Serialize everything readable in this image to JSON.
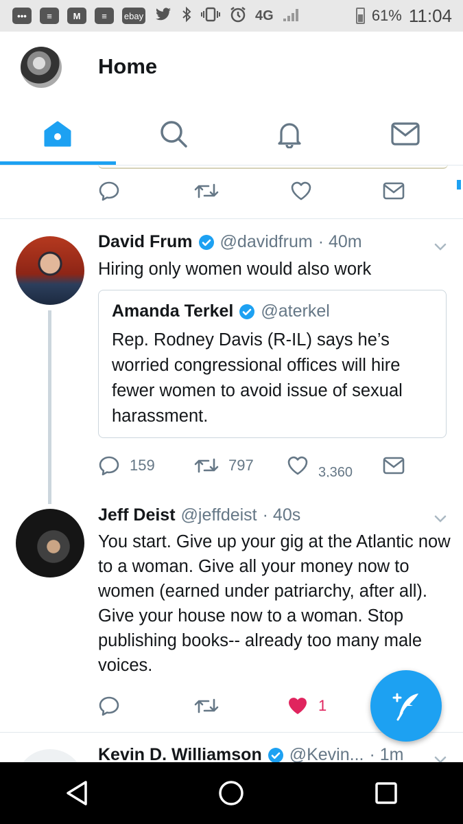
{
  "status_bar": {
    "battery": "61%",
    "time": "11:04",
    "network": "4G",
    "icons": [
      "more-icon",
      "flipboard-icon",
      "gmail-icon",
      "flipboard-icon",
      "ebay-icon",
      "twitter-icon",
      "bluetooth-icon",
      "vibrate-icon",
      "alarm-icon",
      "lte-icon",
      "signal-icon",
      "battery-icon"
    ],
    "ebay_label": "ebay"
  },
  "header": {
    "title": "Home"
  },
  "tabs": [
    {
      "name": "home",
      "icon": "home-icon",
      "active": true
    },
    {
      "name": "search",
      "icon": "search-icon",
      "active": false
    },
    {
      "name": "notifications",
      "icon": "bell-icon",
      "active": false
    },
    {
      "name": "messages",
      "icon": "mail-icon",
      "active": false
    }
  ],
  "colors": {
    "accent": "#1da1f2",
    "secondary_text": "#657786",
    "like": "#e0245e"
  },
  "tweets": [
    {
      "name": "David Frum",
      "verified": true,
      "handle": "@davidfrum",
      "time": "· 40m",
      "text": "Hiring only women would also work",
      "quote": {
        "name": "Amanda Terkel",
        "verified": true,
        "handle": "@aterkel",
        "text": "Rep. Rodney Davis (R-IL) says he’s worried congressional offices will hire fewer women to avoid issue of sexual harassment."
      },
      "replies": "159",
      "retweets": "797",
      "likes": "3,360"
    },
    {
      "name": "Jeff Deist",
      "verified": false,
      "handle": "@jeffdeist",
      "time": "· 40s",
      "text": "You start. Give up your gig at the Atlantic now to a woman. Give all your money now to women (earned under patriarchy, after all). Give your house now to a woman. Stop publishing books-- already too many male voices.",
      "likes": "1",
      "liked": true
    },
    {
      "name": "Kevin D. Williamson",
      "verified": true,
      "handle": "@Kevin...",
      "time": "· 1m"
    }
  ]
}
